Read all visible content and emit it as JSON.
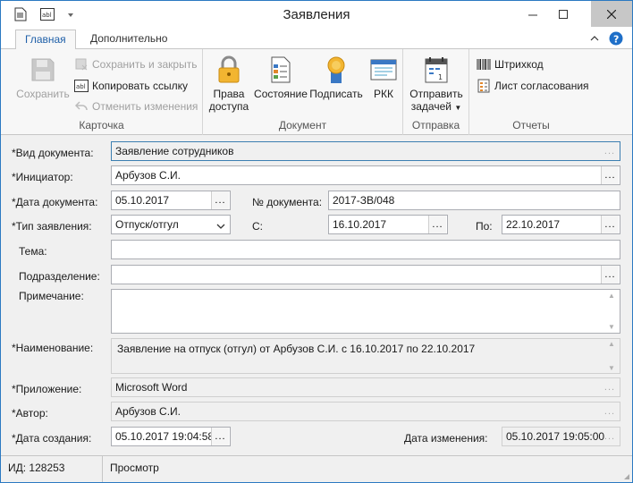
{
  "window": {
    "title": "Заявления"
  },
  "ribbon": {
    "tabs": [
      {
        "label": "Главная"
      },
      {
        "label": "Дополнительно"
      }
    ],
    "groups": {
      "card": {
        "label": "Карточка",
        "save": "Сохранить",
        "save_close": "Сохранить и закрыть",
        "copy_link": "Копировать ссылку",
        "undo": "Отменить изменения"
      },
      "document": {
        "label": "Документ",
        "access_rights_1": "Права",
        "access_rights_2": "доступа",
        "state": "Состояние",
        "sign": "Подписать",
        "rkk": "РКК"
      },
      "send": {
        "label": "Отправка",
        "send_task_1": "Отправить",
        "send_task_2": "задачей"
      },
      "reports": {
        "label": "Отчеты",
        "barcode": "Штрихкод",
        "approval_sheet": "Лист согласования"
      }
    }
  },
  "form": {
    "doc_kind": {
      "label": "*Вид документа:",
      "value": "Заявление сотрудников"
    },
    "initiator": {
      "label": "*Инициатор:",
      "value": "Арбузов С.И."
    },
    "doc_date": {
      "label": "*Дата документа:",
      "value": "05.10.2017"
    },
    "doc_number": {
      "label": "№ документа:",
      "value": "2017-ЗВ/048"
    },
    "request_type": {
      "label": "*Тип заявления:",
      "value": "Отпуск/отгул"
    },
    "from": {
      "label": "С:",
      "value": "16.10.2017"
    },
    "to": {
      "label": "По:",
      "value": "22.10.2017"
    },
    "subject": {
      "label": "Тема:",
      "value": ""
    },
    "department": {
      "label": "Подразделение:",
      "value": ""
    },
    "note": {
      "label": "Примечание:",
      "value": ""
    },
    "name": {
      "label": "*Наименование:",
      "value": "Заявление на отпуск (отгул) от Арбузов С.И. с 16.10.2017 по 22.10.2017"
    },
    "application": {
      "label": "*Приложение:",
      "value": "Microsoft Word"
    },
    "author": {
      "label": "*Автор:",
      "value": "Арбузов С.И."
    },
    "created": {
      "label": "*Дата создания:",
      "value": "05.10.2017 19:04:58"
    },
    "modified": {
      "label": "Дата изменения:",
      "value": "05.10.2017 19:05:00"
    },
    "ellipsis": "..."
  },
  "status": {
    "id": "ИД: 128253",
    "mode": "Просмотр"
  },
  "colors": {
    "accent": "#1e5fa8",
    "border": "#2b79c2"
  }
}
